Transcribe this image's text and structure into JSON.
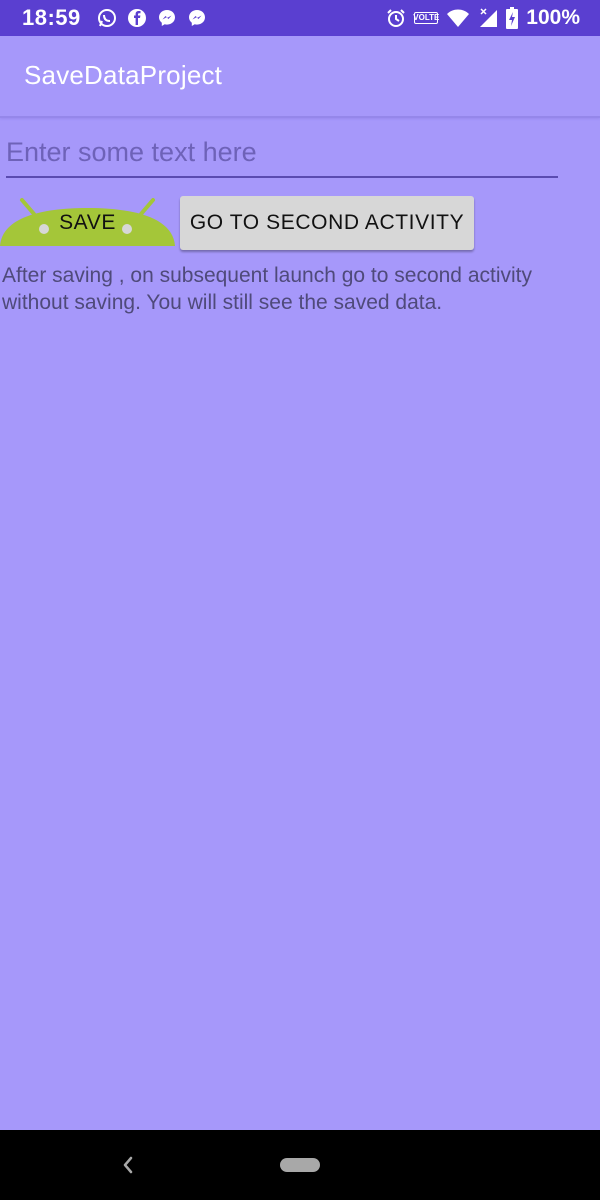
{
  "status_bar": {
    "time": "18:59",
    "left_icons": [
      "whatsapp-icon",
      "facebook-icon",
      "messenger-icon",
      "messenger-icon"
    ],
    "right_icons": [
      "alarm-icon",
      "volte-icon",
      "wifi-icon",
      "cell-signal-icon",
      "battery-charging-icon"
    ],
    "volte_top": "VO",
    "volte_bottom": "LTE",
    "battery": "100%"
  },
  "app_bar": {
    "title": "SaveDataProject"
  },
  "form": {
    "text_input": {
      "value": "",
      "placeholder": "Enter some text here"
    },
    "save_button_label": "SAVE",
    "second_activity_button_label": "GO TO SECOND ACTIVITY"
  },
  "info_text": "After saving , on subsequent launch go to second activity without saving. You will still see the saved data.",
  "nav_bar": {
    "icons": [
      "back-icon",
      "home-pill-icon"
    ]
  },
  "colors": {
    "status_bar": "#5a3fd0",
    "background": "#a698fa",
    "save_button_green": "#a4c639",
    "button_gray": "#d7d7d7",
    "nav_bar": "#000000"
  }
}
